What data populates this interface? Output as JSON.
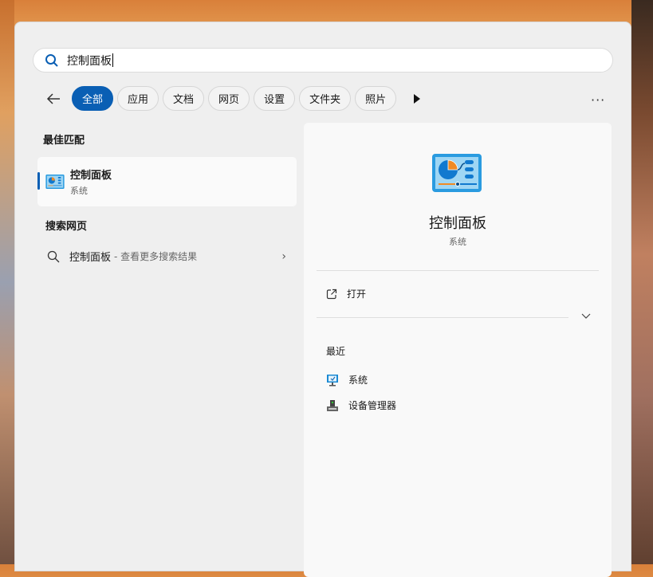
{
  "search": {
    "value": "控制面板"
  },
  "filters": [
    "全部",
    "应用",
    "文档",
    "网页",
    "设置",
    "文件夹",
    "照片"
  ],
  "more_label": "···",
  "best_match": {
    "heading": "最佳匹配",
    "title": "控制面板",
    "subtitle": "系统"
  },
  "web_search": {
    "heading": "搜索网页",
    "query": "控制面板",
    "hint": "- 查看更多搜索结果"
  },
  "detail": {
    "title": "控制面板",
    "subtitle": "系统",
    "open_label": "打开",
    "recent_heading": "最近",
    "recent": [
      {
        "label": "系统",
        "icon": "system-monitor-icon"
      },
      {
        "label": "设备管理器",
        "icon": "device-manager-icon"
      }
    ]
  },
  "colors": {
    "accent": "#0a5fb4"
  }
}
